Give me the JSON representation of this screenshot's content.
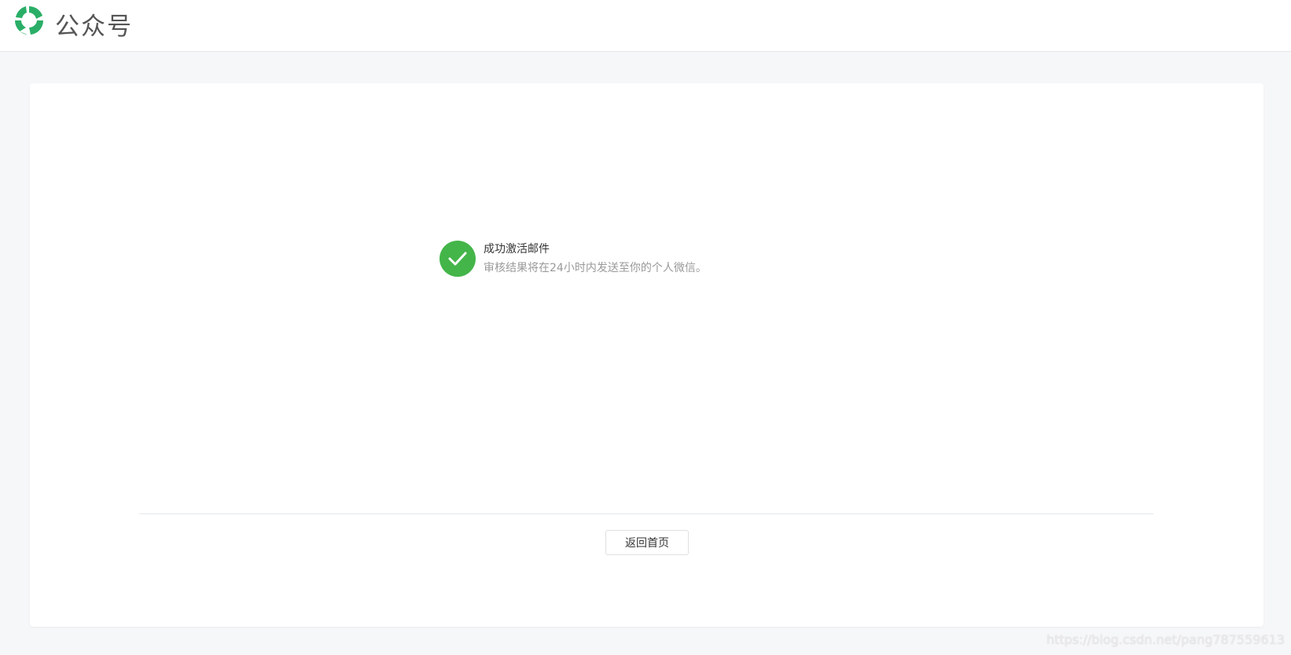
{
  "header": {
    "brand": "公众号"
  },
  "result": {
    "title": "成功激活邮件",
    "description": "审核结果将在24小时内发送至你的个人微信。"
  },
  "actions": {
    "back_home": "返回首页"
  },
  "watermark": "https://blog.csdn.net/pang787559613",
  "colors": {
    "success": "#44b549",
    "brand_green": "#1aad19"
  }
}
